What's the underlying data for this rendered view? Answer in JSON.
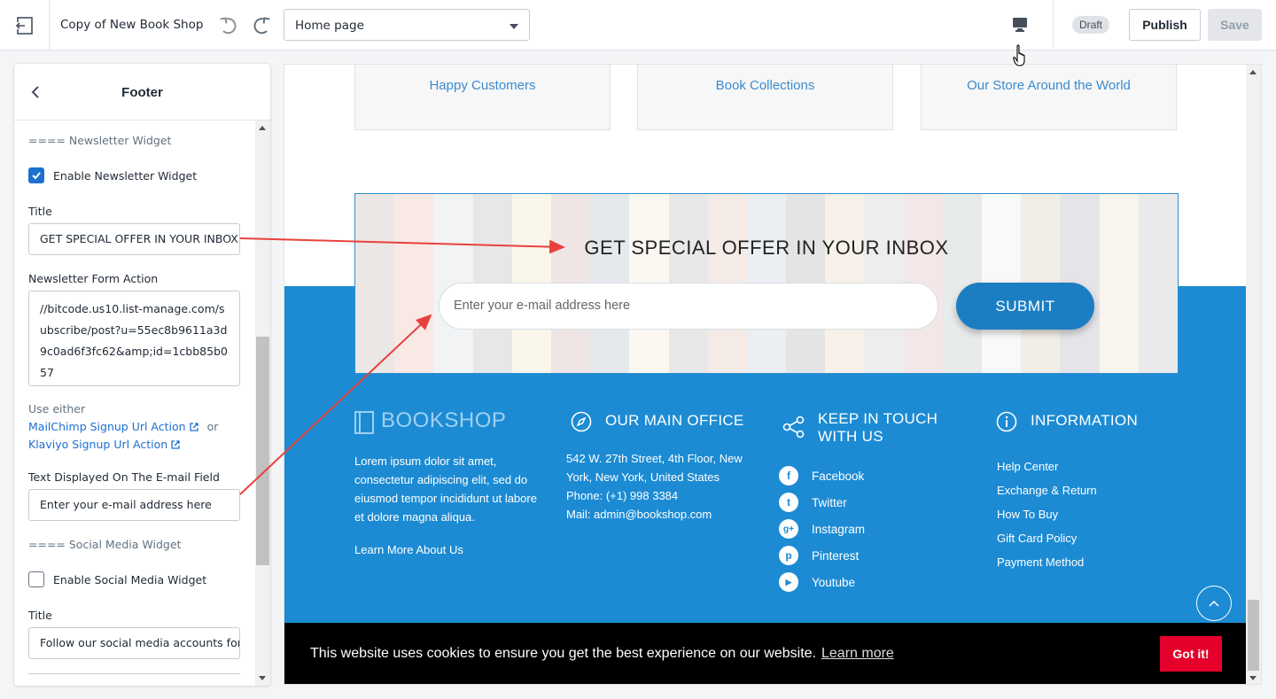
{
  "topbar": {
    "site_title": "Copy of New Book Shop",
    "page_select": "Home page",
    "draft_badge": "Draft",
    "publish_label": "Publish",
    "save_label": "Save"
  },
  "sidebar": {
    "title": "Footer",
    "newsletter_section": "==== Newsletter Widget",
    "enable_newsletter_label": "Enable Newsletter Widget",
    "enable_newsletter_checked": true,
    "title_label": "Title",
    "title_value": "GET SPECIAL OFFER IN YOUR INBOX",
    "form_action_label": "Newsletter Form Action",
    "form_action_value": "//bitcode.us10.list-manage.com/subscribe/post?u=55ec8b9611a3d9c0ad6f3fc62&amp;id=1cbb85b057",
    "use_either": "Use either",
    "mailchimp_link": "MailChimp Signup Url Action",
    "or_text": "or",
    "klaviyo_link": "Klaviyo Signup Url Action",
    "email_text_label": "Text Displayed On The E-mail Field",
    "email_text_value": "Enter your e-mail address here",
    "social_section": "==== Social Media Widget",
    "enable_social_label": "Enable Social Media Widget",
    "enable_social_checked": false,
    "social_title_label": "Title",
    "social_title_value": "Follow our social media accounts for"
  },
  "preview": {
    "stats": [
      "Happy Customers",
      "Book Collections",
      "Our Store Around the World"
    ],
    "newsletter_title": "GET SPECIAL OFFER IN YOUR INBOX",
    "newsletter_placeholder": "Enter your e-mail address here",
    "submit_label": "SUBMIT",
    "brand": "BOOKSHOP",
    "about_text": "Lorem ipsum dolor sit amet, consectetur adipiscing elit, sed do eiusmod tempor incididunt ut labore et dolore magna aliqua.",
    "learn_more": "Learn More About Us",
    "office_heading": "OUR MAIN OFFICE",
    "office_address": "542 W. 27th Street, 4th Floor, New York, New York, United States",
    "office_phone": "Phone: (+1) 998 3384",
    "office_mail": "Mail: admin@bookshop.com",
    "touch_heading_1": "KEEP IN TOUCH",
    "touch_heading_2": "WITH US",
    "social": [
      {
        "name": "Facebook",
        "glyph": "f"
      },
      {
        "name": "Twitter",
        "glyph": "t"
      },
      {
        "name": "Instagram",
        "glyph": "g+"
      },
      {
        "name": "Pinterest",
        "glyph": "p"
      },
      {
        "name": "Youtube",
        "glyph": "▶"
      }
    ],
    "info_heading": "INFORMATION",
    "info_links": [
      "Help Center",
      "Exchange & Return",
      "How To Buy",
      "Gift Card Policy",
      "Payment Method"
    ],
    "cookie_message": "This website uses cookies to ensure you get the best experience on our website.",
    "cookie_learn_more": "Learn more",
    "cookie_button": "Got it!"
  },
  "colors": {
    "footer_blue": "#1c8bd3",
    "submit_blue": "#1c7ec2",
    "cookie_red": "#e4002b",
    "annotation_red": "#e8413c",
    "link_blue": "#1d6fd1"
  }
}
